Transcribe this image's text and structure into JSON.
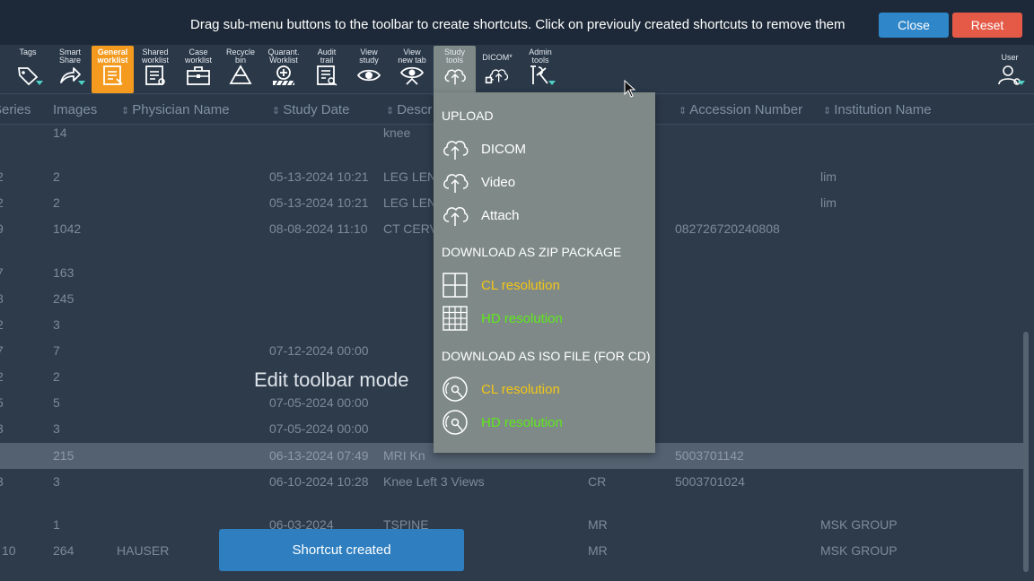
{
  "banner": {
    "message": "Drag sub-menu buttons to the toolbar to create shortcuts. Click on previouly created shortcuts to remove them",
    "close_label": "Close",
    "reset_label": "Reset"
  },
  "toolbar": {
    "items": [
      {
        "label": "Tags",
        "icon": "tag-icon"
      },
      {
        "label": "Smart\nShare",
        "icon": "share-arrow-icon"
      },
      {
        "label": "General\nworklist",
        "icon": "worklist-icon"
      },
      {
        "label": "Shared\nworklist",
        "icon": "shared-worklist-icon"
      },
      {
        "label": "Case\nworklist",
        "icon": "briefcase-icon"
      },
      {
        "label": "Recycle\nbin",
        "icon": "recycle-icon"
      },
      {
        "label": "Quarant.\nWorklist",
        "icon": "quarantine-icon"
      },
      {
        "label": "Audit\ntrail",
        "icon": "audit-icon"
      },
      {
        "label": "View\nstudy",
        "icon": "eye-icon"
      },
      {
        "label": "View\nnew tab",
        "icon": "eye-newtab-icon"
      },
      {
        "label": "Study\ntools",
        "icon": "cloud-upload-icon"
      },
      {
        "label": "DICOM*",
        "icon": "dicom-cloud-icon"
      },
      {
        "label": "Admin\ntools",
        "icon": "admin-tools-icon"
      },
      {
        "label": "User",
        "icon": "user-settings-icon"
      }
    ]
  },
  "table": {
    "headers": [
      "Series",
      "Images",
      "Physician Name",
      "Study Date",
      "Descr",
      "Accession Number",
      "Institution Name"
    ],
    "rows": [
      {
        "series": "",
        "images": "14",
        "physician": "",
        "date": "",
        "desc": "knee",
        "modality": "",
        "accession": "",
        "institution": ""
      },
      {
        "series": "2",
        "images": "2",
        "physician": "",
        "date": "05-13-2024 10:21",
        "desc": "LEG LEN",
        "modality": "",
        "accession": "",
        "institution": "lim"
      },
      {
        "series": "2",
        "images": "2",
        "physician": "",
        "date": "05-13-2024 10:21",
        "desc": "LEG LEN",
        "modality": "",
        "accession": "",
        "institution": "lim"
      },
      {
        "series": "9",
        "images": "1042",
        "physician": "",
        "date": "08-08-2024 11:10",
        "desc": "CT CERV",
        "modality": "",
        "accession": "082726720240808",
        "institution": ""
      },
      {
        "series": "7",
        "images": "163",
        "physician": "",
        "date": "",
        "desc": "",
        "modality": "",
        "accession": "",
        "institution": ""
      },
      {
        "series": "8",
        "images": "245",
        "physician": "",
        "date": "",
        "desc": "",
        "modality": "",
        "accession": "",
        "institution": ""
      },
      {
        "series": "2",
        "images": "3",
        "physician": "",
        "date": "",
        "desc": "",
        "modality": "",
        "accession": "",
        "institution": ""
      },
      {
        "series": "7",
        "images": "7",
        "physician": "",
        "date": "07-12-2024 00:00",
        "desc": "",
        "modality": "",
        "accession": "",
        "institution": ""
      },
      {
        "series": "2",
        "images": "2",
        "physician": "",
        "date": "",
        "desc": "",
        "modality": "",
        "accession": "",
        "institution": ""
      },
      {
        "series": "5",
        "images": "5",
        "physician": "",
        "date": "07-05-2024 00:00",
        "desc": "",
        "modality": "",
        "accession": "",
        "institution": ""
      },
      {
        "series": "3",
        "images": "3",
        "physician": "",
        "date": "07-05-2024 00:00",
        "desc": "",
        "modality": "",
        "accession": "",
        "institution": ""
      },
      {
        "series": "",
        "images": "215",
        "physician": "",
        "date": "06-13-2024 07:49",
        "desc": "MRI Kn",
        "modality": "",
        "accession": "5003701142",
        "institution": ""
      },
      {
        "series": "3",
        "images": "3",
        "physician": "",
        "date": "06-10-2024 10:28",
        "desc": "Knee Left 3 Views",
        "modality": "CR",
        "accession": "5003701024",
        "institution": ""
      },
      {
        "series": "",
        "images": "1",
        "physician": "",
        "date": "06-03-2024",
        "desc": "TSPINE",
        "modality": "MR",
        "accession": "",
        "institution": "MSK GROUP"
      },
      {
        "series": "10",
        "images": "264",
        "physician": "HAUSER",
        "date": "",
        "desc": "",
        "modality": "MR",
        "accession": "",
        "institution": "MSK GROUP"
      }
    ]
  },
  "edit_mode_label": "Edit toolbar mode",
  "toast": "Shortcut created",
  "menu": {
    "sections": [
      {
        "heading": "UPLOAD",
        "items": [
          {
            "label": "DICOM",
            "icon": "cloud-upload-icon",
            "color": "#ffffff"
          },
          {
            "label": "Video",
            "icon": "cloud-upload-icon",
            "color": "#ffffff"
          },
          {
            "label": "Attach",
            "icon": "cloud-upload-icon",
            "color": "#ffffff"
          }
        ]
      },
      {
        "heading": "DOWNLOAD AS ZIP PACKAGE",
        "items": [
          {
            "label": "CL resolution",
            "icon": "grid-2x2-icon",
            "color": "#f3c613"
          },
          {
            "label": "HD resolution",
            "icon": "grid-4x4-icon",
            "color": "#5ee81c"
          }
        ]
      },
      {
        "heading": "DOWNLOAD AS ISO FILE (FOR CD)",
        "items": [
          {
            "label": "CL resolution",
            "icon": "disc-icon",
            "color": "#f3c613"
          },
          {
            "label": "HD resolution",
            "icon": "disc-icon",
            "color": "#5ee81c"
          }
        ]
      }
    ]
  }
}
